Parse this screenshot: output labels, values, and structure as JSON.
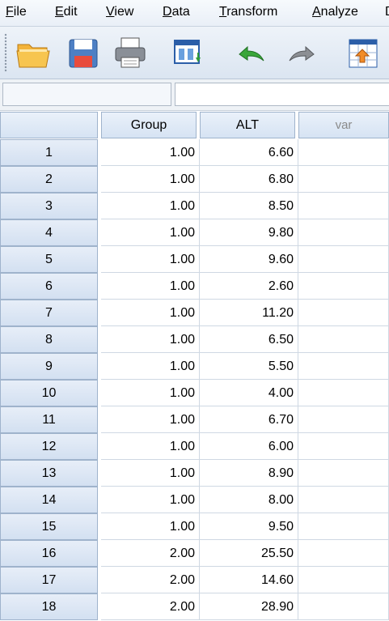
{
  "menu": {
    "items": [
      "File",
      "Edit",
      "View",
      "Data",
      "Transform",
      "Analyze",
      "D"
    ],
    "mnemonics": [
      "F",
      "E",
      "V",
      "D",
      "T",
      "A",
      ""
    ]
  },
  "toolbar": {
    "buttons": [
      "open-folder-icon",
      "save-icon",
      "print-icon",
      "recall-dialog-icon",
      "undo-icon",
      "redo-icon",
      "go-to-case-icon"
    ]
  },
  "cell_editor": {
    "name": "",
    "value": ""
  },
  "grid": {
    "columns": [
      "Group",
      "ALT",
      "var"
    ],
    "rows": [
      {
        "num": "1",
        "group": "1.00",
        "alt": "6.60"
      },
      {
        "num": "2",
        "group": "1.00",
        "alt": "6.80"
      },
      {
        "num": "3",
        "group": "1.00",
        "alt": "8.50"
      },
      {
        "num": "4",
        "group": "1.00",
        "alt": "9.80"
      },
      {
        "num": "5",
        "group": "1.00",
        "alt": "9.60"
      },
      {
        "num": "6",
        "group": "1.00",
        "alt": "2.60"
      },
      {
        "num": "7",
        "group": "1.00",
        "alt": "11.20"
      },
      {
        "num": "8",
        "group": "1.00",
        "alt": "6.50"
      },
      {
        "num": "9",
        "group": "1.00",
        "alt": "5.50"
      },
      {
        "num": "10",
        "group": "1.00",
        "alt": "4.00"
      },
      {
        "num": "11",
        "group": "1.00",
        "alt": "6.70"
      },
      {
        "num": "12",
        "group": "1.00",
        "alt": "6.00"
      },
      {
        "num": "13",
        "group": "1.00",
        "alt": "8.90"
      },
      {
        "num": "14",
        "group": "1.00",
        "alt": "8.00"
      },
      {
        "num": "15",
        "group": "1.00",
        "alt": "9.50"
      },
      {
        "num": "16",
        "group": "2.00",
        "alt": "25.50"
      },
      {
        "num": "17",
        "group": "2.00",
        "alt": "14.60"
      },
      {
        "num": "18",
        "group": "2.00",
        "alt": "28.90"
      }
    ]
  },
  "colors": {
    "header_blue": "#d6e3f3",
    "grid_line": "#cfd8e3",
    "undo_green": "#3aa63a"
  }
}
